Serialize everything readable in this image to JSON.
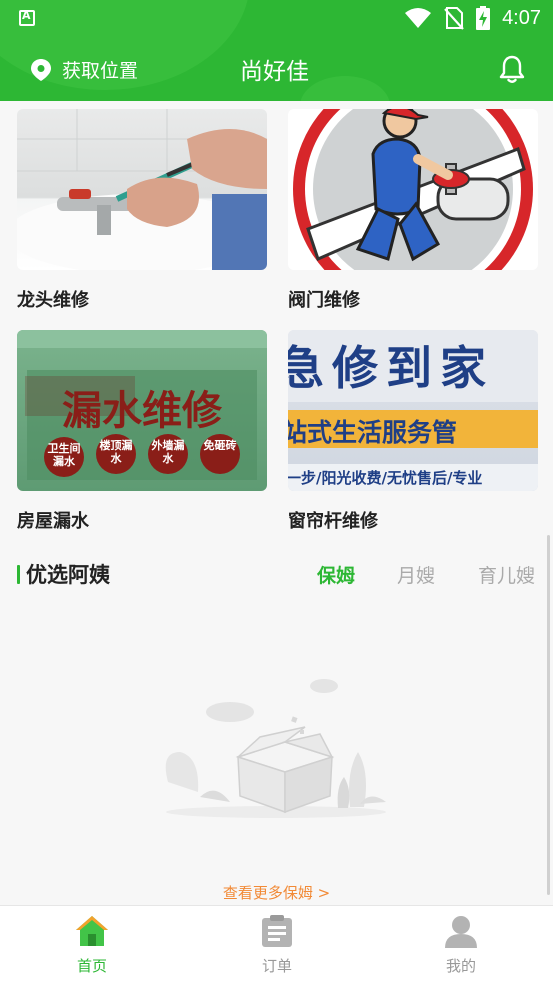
{
  "status_bar": {
    "time": "4:07"
  },
  "header": {
    "location_label": "获取位置",
    "title": "尚好佳"
  },
  "services": [
    {
      "label": "龙头维修",
      "icon": "faucet-repair-photo"
    },
    {
      "label": "阀门维修",
      "icon": "valve-repair-illustration"
    },
    {
      "label": "房屋漏水",
      "icon": "leak-repair-banner",
      "image_text": {
        "main": "漏水维修",
        "badges": [
          "卫生间漏水",
          "楼顶漏水",
          "外墙漏水",
          "免砸砖"
        ]
      }
    },
    {
      "label": "窗帘杆维修",
      "icon": "repair-service-banner",
      "image_text": {
        "line1": "急修到家",
        "line2": "站式生活服务管",
        "line3": "一步/阳光收费/无忧售后/专业"
      }
    }
  ],
  "section": {
    "title": "优选阿姨",
    "tabs": [
      {
        "label": "保姆",
        "active": true
      },
      {
        "label": "月嫂",
        "active": false
      },
      {
        "label": "育儿嫂",
        "active": false
      }
    ]
  },
  "more_link": "查看更多保姆 >",
  "bottom_nav": [
    {
      "label": "首页",
      "icon": "home-icon",
      "active": true
    },
    {
      "label": "订单",
      "icon": "clipboard-icon",
      "active": false
    },
    {
      "label": "我的",
      "icon": "profile-icon",
      "active": false
    }
  ],
  "colors": {
    "brand": "#2db734",
    "accent_link": "#f28a36"
  }
}
